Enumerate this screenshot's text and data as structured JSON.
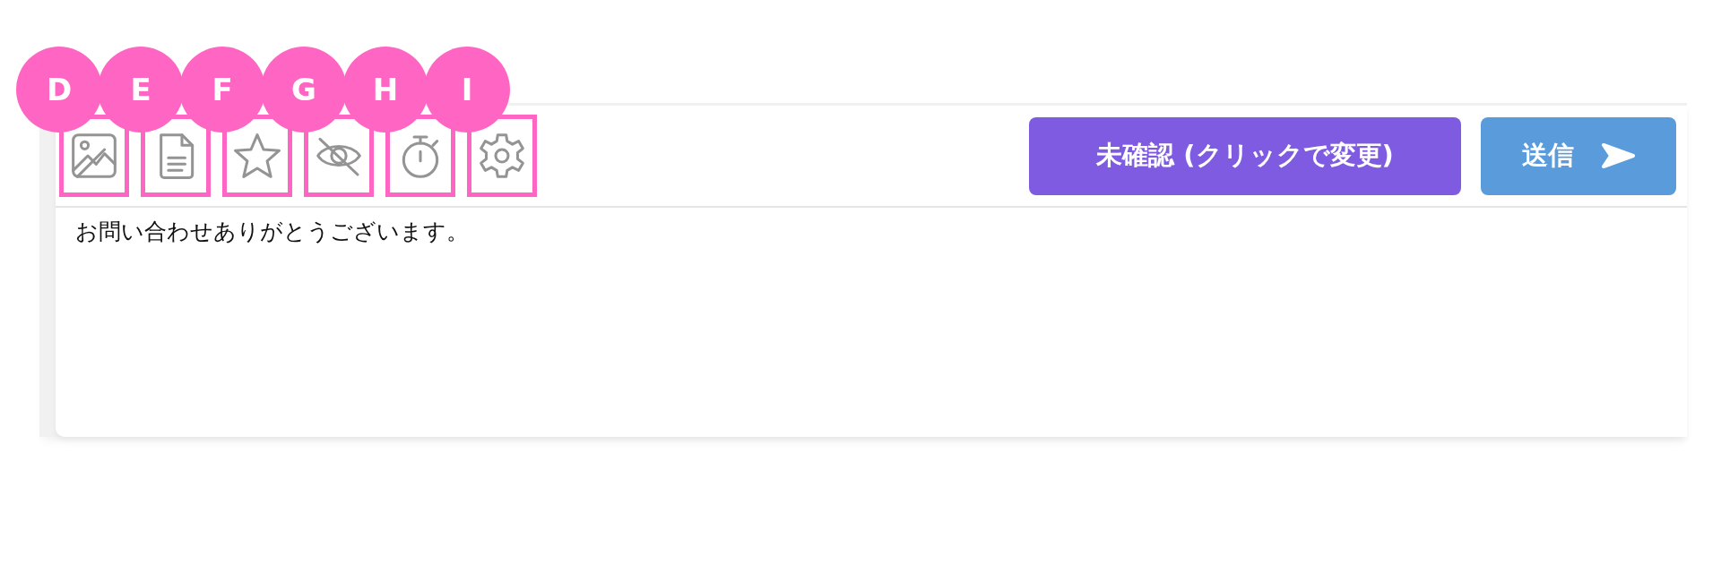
{
  "toolbar": [
    {
      "kind": "image",
      "callout": "D"
    },
    {
      "kind": "document",
      "callout": "E"
    },
    {
      "kind": "star",
      "callout": "F"
    },
    {
      "kind": "hidden",
      "callout": "G"
    },
    {
      "kind": "timer",
      "callout": "H"
    },
    {
      "kind": "settings",
      "callout": "I"
    }
  ],
  "status_button": {
    "label": "未確認 (クリックで変更)"
  },
  "send_button": {
    "label": "送信"
  },
  "message": {
    "value": "お問い合わせありがとうございます。"
  }
}
